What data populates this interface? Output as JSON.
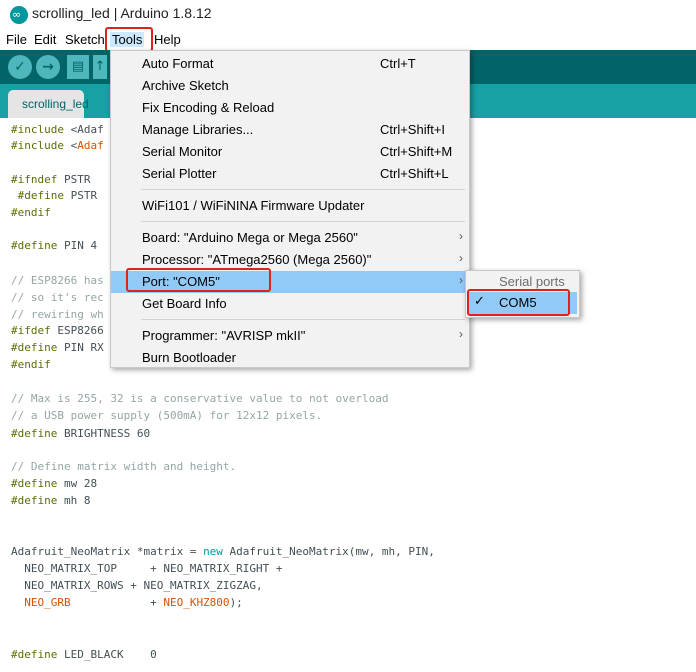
{
  "window": {
    "title": "scrolling_led | Arduino 1.8.12",
    "icon": "arduino-logo-icon"
  },
  "menubar": {
    "file": "File",
    "edit": "Edit",
    "sketch": "Sketch",
    "tools": "Tools",
    "help": "Help"
  },
  "toolbar": {
    "verify_icon": "check-icon",
    "upload_icon": "arrow-right-icon",
    "new_icon": "new-file-icon",
    "open_icon": "upload-arrow-icon"
  },
  "tabs": [
    {
      "label": "scrolling_led"
    }
  ],
  "tools_menu": {
    "items": [
      {
        "label": "Auto Format",
        "shortcut": "Ctrl+T"
      },
      {
        "label": "Archive Sketch"
      },
      {
        "label": "Fix Encoding & Reload"
      },
      {
        "label": "Manage Libraries...",
        "shortcut": "Ctrl+Shift+I"
      },
      {
        "label": "Serial Monitor",
        "shortcut": "Ctrl+Shift+M"
      },
      {
        "label": "Serial Plotter",
        "shortcut": "Ctrl+Shift+L"
      },
      {
        "label": "WiFi101 / WiFiNINA Firmware Updater"
      },
      {
        "label": "Board: \"Arduino Mega or Mega 2560\""
      },
      {
        "label": "Processor: \"ATmega2560 (Mega 2560)\""
      },
      {
        "label": "Port: \"COM5\""
      },
      {
        "label": "Get Board Info"
      },
      {
        "label": "Programmer: \"AVRISP mkII\""
      },
      {
        "label": "Burn Bootloader"
      }
    ]
  },
  "port_submenu": {
    "header": "Serial ports",
    "item": "COM5",
    "check": "✓"
  },
  "code": {
    "l1": [
      "#include",
      " <Adaf"
    ],
    "l2": [
      "#include",
      " <"
    ],
    "l2b": "Adaf",
    "l3": [
      "#ifndef",
      " PSTR"
    ],
    "l4": [
      " #define",
      " PSTR"
    ],
    "l5": "#endif",
    "l6": [
      "#define",
      " PIN 4"
    ],
    "l7": "// ESP8266 has",
    "l8": "// so it's rec",
    "l9": "// rewiring wh",
    "l10": [
      "#ifdef",
      " ESP8266"
    ],
    "l11": [
      "#define",
      " PIN RX"
    ],
    "l12": "#endif",
    "l13": "// Max is 255, 32 is a conservative value to not overload",
    "l14": "// a USB power supply (500mA) for 12x12 pixels.",
    "l15": [
      "#define",
      " BRIGHTNESS 60"
    ],
    "l16": "// Define matrix width and height.",
    "l17": [
      "#define",
      " mw 28"
    ],
    "l18": [
      "#define",
      " mh 8"
    ],
    "l19a": "Adafruit_NeoMatrix *matrix = ",
    "l19b": "new",
    "l19c": " Adafruit_NeoMatrix(mw, mh, PIN,",
    "l20": "  NEO_MATRIX_TOP     + NEO_MATRIX_RIGHT +",
    "l21": "  NEO_MATRIX_ROWS + NEO_MATRIX_ZIGZAG,",
    "l22a": "  NEO_GRB",
    "l22b": "            + ",
    "l22c": "NEO_KHZ800",
    "l22d": ");",
    "l23": [
      "#define",
      " LED_BLACK    0"
    ]
  }
}
